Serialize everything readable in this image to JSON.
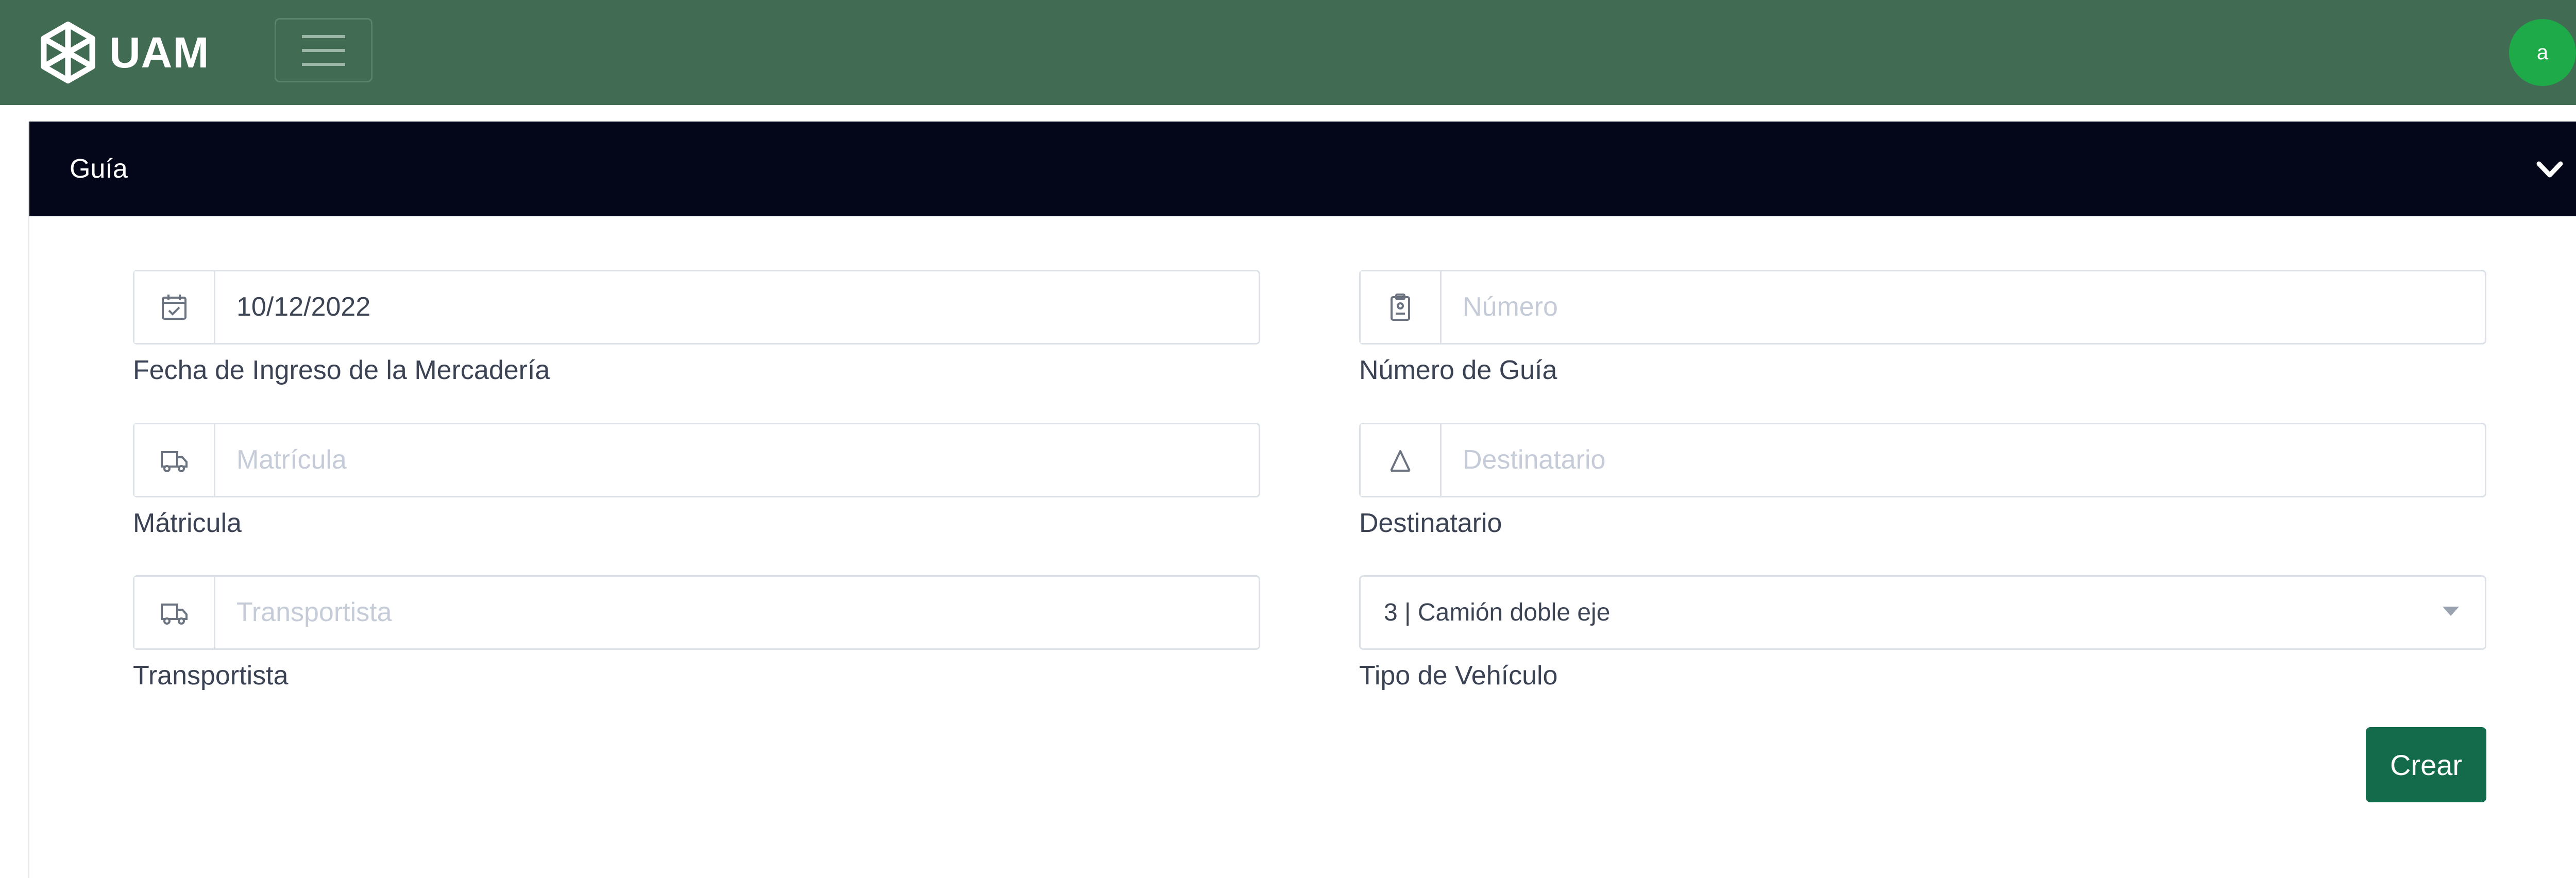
{
  "navbar": {
    "brand": "UAM",
    "user_initial": "a",
    "colors": {
      "background": "#416b53",
      "avatar": "#1faa4a"
    }
  },
  "card": {
    "title": "Guía",
    "header_color": "#04071a"
  },
  "form": {
    "fecha": {
      "icon": "calendar-check-icon",
      "value": "10/12/2022",
      "label": "Fecha de Ingreso de la Mercadería"
    },
    "numero": {
      "icon": "clipboard-icon",
      "placeholder": "Número",
      "label": "Número de Guía"
    },
    "matricula": {
      "icon": "truck-icon",
      "placeholder": "Matrícula",
      "label": "Mátricula"
    },
    "destinatario": {
      "icon": "user-icon",
      "placeholder": "Destinatario",
      "label": "Destinatario"
    },
    "transportista": {
      "icon": "truck-icon",
      "placeholder": "Transportista",
      "label": "Transportista"
    },
    "tipo_vehiculo": {
      "selected": "3 | Camión doble eje",
      "label": "Tipo de Vehículo"
    },
    "submit_label": "Crear",
    "submit_color": "#146b4c"
  }
}
